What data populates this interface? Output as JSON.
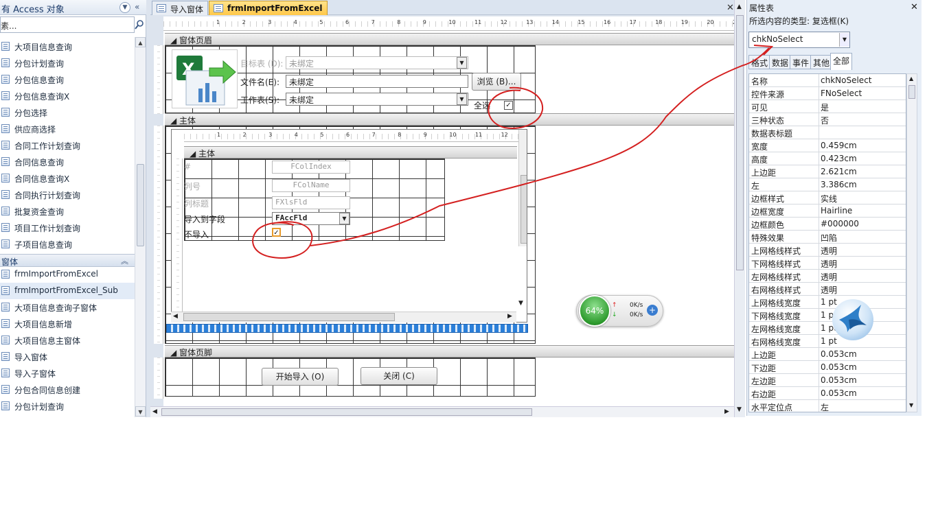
{
  "nav": {
    "title": "有 Access 对象",
    "search_text": "素...",
    "queries": [
      "大项目信息查询",
      "分包计划查询",
      "分包信息查询",
      "分包信息查询X",
      "分包选择",
      "供应商选择",
      "合同工作计划查询",
      "合同信息查询",
      "合同信息查询X",
      "合同执行计划查询",
      "批复资金查询",
      "项目工作计划查询",
      "子项目信息查询"
    ],
    "group_label": "窗体",
    "forms": [
      "frmImportFromExcel",
      "frmImportFromExcel_Sub",
      "大项目信息查询子窗体",
      "大项目信息新增",
      "大项目信息主窗体",
      "导入窗体",
      "导入子窗体",
      "分包合同信息创建",
      "分包计划查询"
    ],
    "selected_form": "frmImportFromExcel_Sub"
  },
  "tabs": [
    {
      "label": "导入窗体"
    },
    {
      "label": "frmImportFromExcel"
    }
  ],
  "design": {
    "ruler_numbers": [
      "1",
      "2",
      "3",
      "4",
      "5",
      "6",
      "7",
      "8",
      "9",
      "10",
      "11",
      "12",
      "13",
      "14",
      "15",
      "16",
      "17",
      "18",
      "19",
      "20",
      "21",
      "22"
    ],
    "form_header": "窗体页眉",
    "target_label": "目标表 (D):",
    "target_value": "未绑定",
    "file_label": "文件名(E):",
    "file_value": "未绑定",
    "browse_button": "浏览 (B)...",
    "sheet_label": "工作表(S):",
    "sheet_value": "未绑定",
    "select_all_label": "全选",
    "detail": "主体",
    "sub_detail": "主体",
    "sub_ruler_numbers": [
      "1",
      "2",
      "3",
      "4",
      "5",
      "6",
      "7",
      "8",
      "9",
      "10",
      "11",
      "12"
    ],
    "sub_fields": [
      {
        "label": "#",
        "value": "FColIndex"
      },
      {
        "label": "列号",
        "value": "FColName"
      },
      {
        "label": "列标题",
        "value": "FXlsFld"
      },
      {
        "label": "导入到字段",
        "value": "FAccFld"
      }
    ],
    "no_import_label": "不导入",
    "form_footer": "窗体页脚",
    "start_button": "开始导入 (O)",
    "close_button": "关闭 (C)"
  },
  "netmeter": {
    "percent": "64%",
    "up": "0K/s",
    "down": "0K/s"
  },
  "props": {
    "title": "属性表",
    "type_label": "所选内容的类型: 复选框(K)",
    "selected_control": "chkNoSelect",
    "tabs": [
      "格式",
      "数据",
      "事件",
      "其他",
      "全部"
    ],
    "active_tab": "全部",
    "rows": [
      {
        "k": "名称",
        "v": "chkNoSelect"
      },
      {
        "k": "控件来源",
        "v": "FNoSelect"
      },
      {
        "k": "可见",
        "v": "是"
      },
      {
        "k": "三种状态",
        "v": "否"
      },
      {
        "k": "数据表标题",
        "v": ""
      },
      {
        "k": "宽度",
        "v": "0.459cm"
      },
      {
        "k": "高度",
        "v": "0.423cm"
      },
      {
        "k": "上边距",
        "v": "2.621cm"
      },
      {
        "k": "左",
        "v": "3.386cm"
      },
      {
        "k": "边框样式",
        "v": "实线"
      },
      {
        "k": "边框宽度",
        "v": "Hairline"
      },
      {
        "k": "边框颜色",
        "v": "#000000"
      },
      {
        "k": "特殊效果",
        "v": "凹陷"
      },
      {
        "k": "上网格线样式",
        "v": "透明"
      },
      {
        "k": "下网格线样式",
        "v": "透明"
      },
      {
        "k": "左网格线样式",
        "v": "透明"
      },
      {
        "k": "右网格线样式",
        "v": "透明"
      },
      {
        "k": "上网格线宽度",
        "v": "1 pt"
      },
      {
        "k": "下网格线宽度",
        "v": "1 pt"
      },
      {
        "k": "左网格线宽度",
        "v": "1 pt"
      },
      {
        "k": "右网格线宽度",
        "v": "1 pt"
      },
      {
        "k": "上边距",
        "v": "0.053cm"
      },
      {
        "k": "下边距",
        "v": "0.053cm"
      },
      {
        "k": "左边距",
        "v": "0.053cm"
      },
      {
        "k": "右边距",
        "v": "0.053cm"
      },
      {
        "k": "水平定位点",
        "v": "左"
      }
    ]
  },
  "colors": {
    "annotation": "#d42020",
    "accent_tab": "#ffc84a",
    "progress": "#2b7fd9"
  },
  "icons": [
    "chevron-down-icon",
    "double-chevron-left-icon",
    "search-icon",
    "form-icon",
    "excel-icon",
    "close-icon",
    "bird-icon"
  ]
}
